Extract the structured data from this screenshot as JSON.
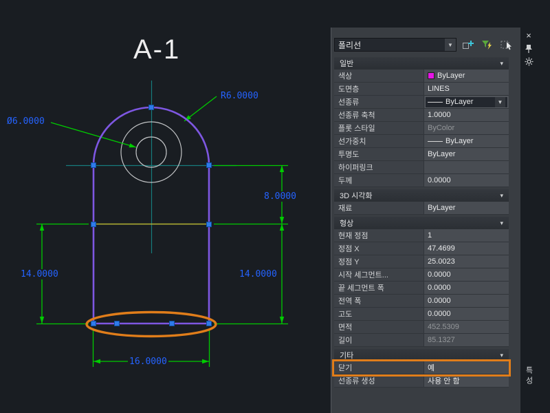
{
  "canvas": {
    "title": "A-1",
    "dim_radius": "R6.0000",
    "dim_diameter": "Ø6.0000",
    "dim_height_upper": "8.0000",
    "dim_height_left": "14.0000",
    "dim_height_right": "14.0000",
    "dim_width_bottom": "16.0000",
    "colors": {
      "background": "#191d22",
      "polyline": "#7e57e2",
      "dimension_lines": "#00cc00",
      "dimension_text": "#2563ff",
      "highlight_orange": "#e07d1a",
      "crosshair": "#177d7d",
      "construction_line": "#b5b533",
      "grip_blue": "#2e7bea",
      "circle_gray": "#c3c5c7"
    }
  },
  "palette": {
    "object_type": "폴리선",
    "vertical_title": "특성",
    "icons": {
      "close": "×",
      "dropdown_arrow": "▼",
      "section_chevron": "▾"
    },
    "sections": {
      "general": {
        "title": "일반",
        "rows": [
          {
            "label": "색상",
            "value": "ByLayer"
          },
          {
            "label": "도면층",
            "value": "LINES"
          },
          {
            "label": "선종류",
            "value": "ByLayer"
          },
          {
            "label": "선종류 축척",
            "value": "1.0000"
          },
          {
            "label": "플롯 스타일",
            "value": "ByColor"
          },
          {
            "label": "선가중치",
            "value": "ByLayer"
          },
          {
            "label": "투명도",
            "value": "ByLayer"
          },
          {
            "label": "하이퍼링크",
            "value": ""
          },
          {
            "label": "두께",
            "value": "0.0000"
          }
        ]
      },
      "visual3d": {
        "title": "3D 시각화",
        "rows": [
          {
            "label": "재료",
            "value": "ByLayer"
          }
        ]
      },
      "geometry": {
        "title": "형상",
        "rows": [
          {
            "label": "현재 정점",
            "value": "1"
          },
          {
            "label": "정점 X",
            "value": "47.4699"
          },
          {
            "label": "정점 Y",
            "value": "25.0023"
          },
          {
            "label": "시작 세그먼트...",
            "value": "0.0000"
          },
          {
            "label": "끝 세그먼트 폭",
            "value": "0.0000"
          },
          {
            "label": "전역 폭",
            "value": "0.0000"
          },
          {
            "label": "고도",
            "value": "0.0000"
          },
          {
            "label": "면적",
            "value": "452.5309"
          },
          {
            "label": "길이",
            "value": "85.1327"
          }
        ]
      },
      "misc": {
        "title": "기타",
        "rows": [
          {
            "label": "닫기",
            "value": "예"
          },
          {
            "label": "선종류 생성",
            "value": "사용 안 함"
          }
        ]
      }
    }
  }
}
